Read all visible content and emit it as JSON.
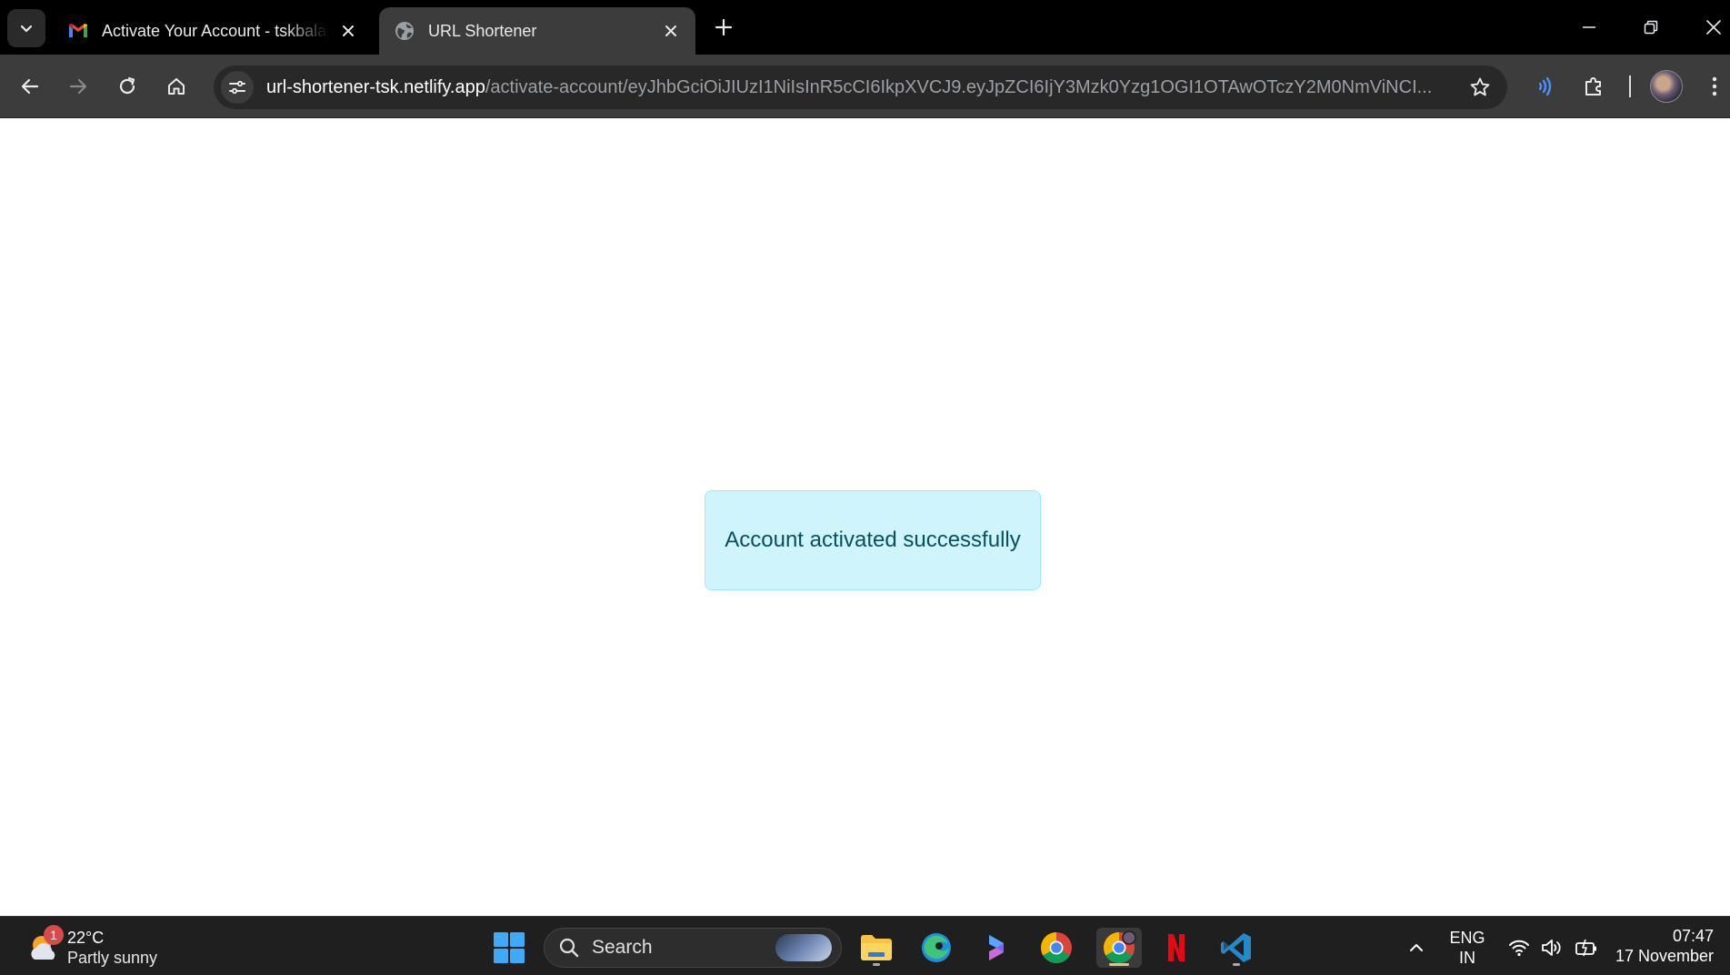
{
  "browser": {
    "tabs": [
      {
        "title": "Activate Your Account - tskbalaji",
        "favicon": "gmail-icon",
        "active": false
      },
      {
        "title": "URL Shortener",
        "favicon": "globe-icon",
        "active": true
      }
    ],
    "url_host": "url-shortener-tsk.netlify.app",
    "url_path": "/activate-account/eyJhbGciOiJIUzI1NiIsInR5cCI6IkpXVCJ9.eyJpZCI6IjY3Mzk0Yzg1OGI1OTAwOTczY2M0NmViNCI..."
  },
  "page": {
    "alert_message": "Account activated successfully",
    "alert_bg": "#cff4fc",
    "alert_text_color": "#055160"
  },
  "taskbar": {
    "weather_badge": "1",
    "weather_temp": "22°C",
    "weather_condition": "Partly sunny",
    "search_label": "Search",
    "language_line1": "ENG",
    "language_line2": "IN",
    "time": "07:47",
    "date": "17 November"
  }
}
